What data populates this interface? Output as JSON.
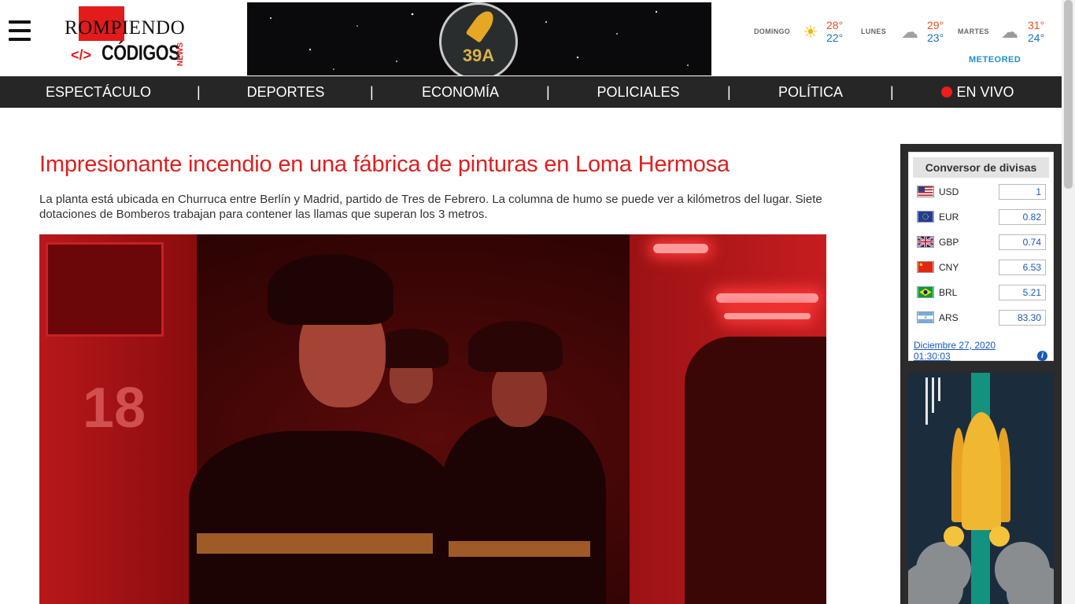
{
  "header": {
    "logo_top": "ROMPIENDO",
    "logo_code_symbol": "</>",
    "logo_bottom": "CÓDIGOS",
    "logo_news": "NEWS",
    "banner_text": "39A"
  },
  "weather": {
    "days": [
      {
        "name": "DOMINGO",
        "icon": "sun-icon",
        "high": "28°",
        "low": "22°"
      },
      {
        "name": "LUNES",
        "icon": "cloud-icon",
        "high": "29°",
        "low": "23°"
      },
      {
        "name": "MARTES",
        "icon": "cloud-sun-rain-icon",
        "high": "31°",
        "low": "24°"
      }
    ],
    "provider": "METEORED"
  },
  "nav": {
    "items": [
      "ESPECTÁCULO",
      "DEPORTES",
      "ECONOMÍA",
      "POLICIALES",
      "POLÍTICA",
      "EN VIVO"
    ],
    "separator": "|"
  },
  "article": {
    "headline": "Impresionante incendio en una fábrica de pinturas en Loma Hermosa",
    "lede": "La planta está ubicada en Churruca entre Berlín y Madrid, partido de Tres de Febrero. La columna de humo se puede ver a kilómetros del lugar. Siete dotaciones de Bomberos trabajan para contener las llamas que superan los 3 metros.",
    "image_text": "18"
  },
  "fx": {
    "title": "Conversor de divisas",
    "rows": [
      {
        "code": "USD",
        "value": "1",
        "flag": "us-flag"
      },
      {
        "code": "EUR",
        "value": "0.82",
        "flag": "eu-flag"
      },
      {
        "code": "GBP",
        "value": "0.74",
        "flag": "gb-flag"
      },
      {
        "code": "CNY",
        "value": "6.53",
        "flag": "cn-flag"
      },
      {
        "code": "BRL",
        "value": "5.21",
        "flag": "br-flag"
      },
      {
        "code": "ARS",
        "value": "83.30",
        "flag": "ar-flag"
      }
    ],
    "date": "Diciembre 27, 2020",
    "time": "01:30:03",
    "info": "i"
  },
  "colors": {
    "accent": "#e01e1e",
    "nav_bg": "#262626",
    "link": "#1a57b6",
    "temp_high": "#e8501e",
    "temp_low": "#1c74b8"
  }
}
